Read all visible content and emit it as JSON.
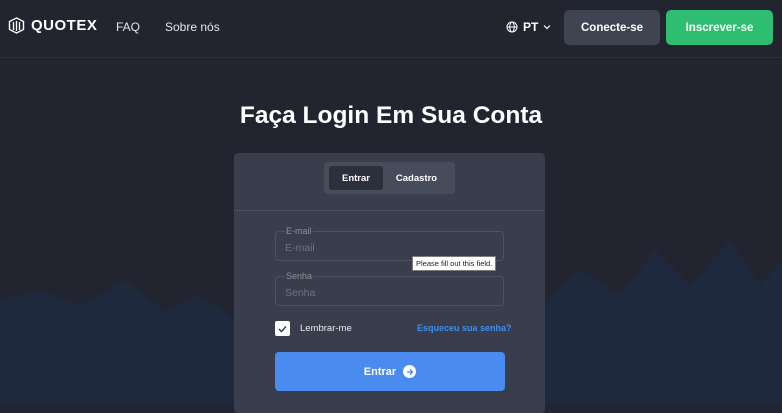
{
  "header": {
    "logo_text": "QUOTEX",
    "nav": [
      "FAQ",
      "Sobre nós"
    ],
    "language": "PT",
    "connect_label": "Conecte-se",
    "signup_label": "Inscrever-se"
  },
  "page_title": "Faça Login Em Sua Conta",
  "tabs": {
    "login": "Entrar",
    "register": "Cadastro"
  },
  "form": {
    "email": {
      "label": "E-mail",
      "placeholder": "E-mail",
      "value": ""
    },
    "password": {
      "label": "Senha",
      "placeholder": "Senha",
      "value": ""
    },
    "validation_tooltip": "Please fill out this field.",
    "remember_label": "Lembrar-me",
    "remember_checked": true,
    "forgot_label": "Esqueceu sua senha?",
    "submit_label": "Entrar"
  },
  "colors": {
    "background": "#22252f",
    "card": "#3a3e4c",
    "primary": "#4a8bf0",
    "signup": "#2fbd72",
    "link": "#3d8ef0"
  }
}
